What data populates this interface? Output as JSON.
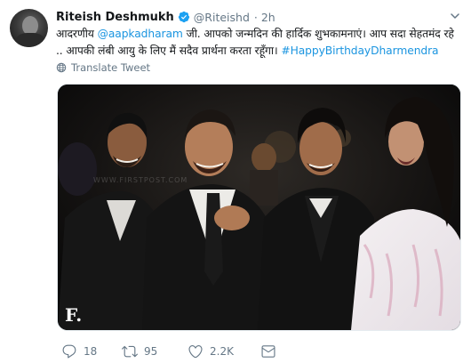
{
  "author": {
    "display_name": "Riteish Deshmukh",
    "handle": "@Riteishd",
    "separator": "·",
    "time": "2h",
    "verified": true
  },
  "tweet": {
    "text_part1": "आदरणीय ",
    "mention": "@aapkadharam",
    "text_part2": " जी. आपको जन्मदिन की हार्दिक शुभकामनाएं। आप सदा सेहतमंद रहे .. आपकी लंबी आयु के लिए मैं सदैव प्रार्थना करता रहूँगा। ",
    "hashtag": "#HappyBirthdayDharmendra"
  },
  "translate": {
    "label": "Translate Tweet",
    "icon": "globe-icon"
  },
  "media": {
    "watermark": "F.",
    "background_text": "WWW.FIRSTPOST.COM"
  },
  "actions": {
    "reply_count": "18",
    "retweet_count": "95",
    "like_count": "2.2K"
  },
  "colors": {
    "link": "#1b95e0",
    "muted": "#657786",
    "text": "#14171a",
    "verified": "#1da1f2"
  }
}
